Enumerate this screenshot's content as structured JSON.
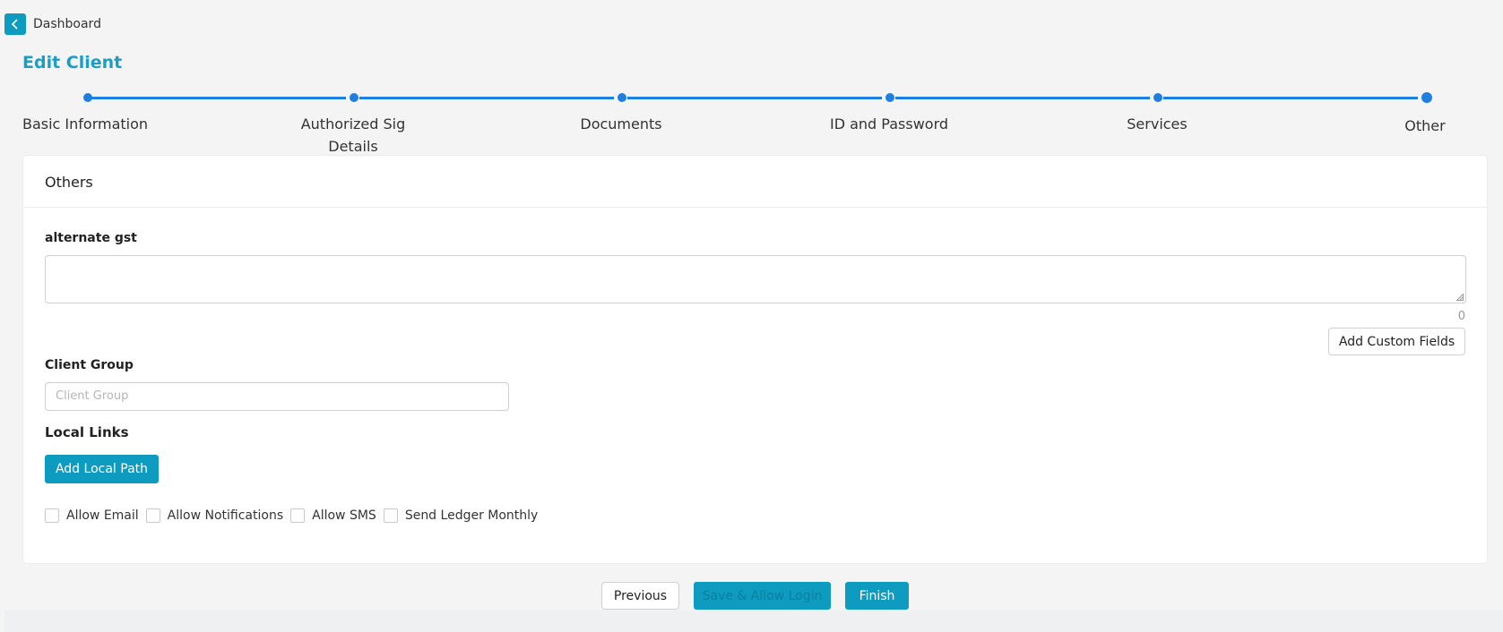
{
  "header": {
    "breadcrumb": "Dashboard",
    "title": "Edit Client"
  },
  "stepper": {
    "steps": [
      {
        "label": "Basic Information"
      },
      {
        "label": "Authorized Sig Details"
      },
      {
        "label": "Documents"
      },
      {
        "label": "ID and Password"
      },
      {
        "label": "Services"
      },
      {
        "label": "Other"
      }
    ],
    "active_index": 5
  },
  "card": {
    "title": "Others",
    "alternate_gst": {
      "label": "alternate gst",
      "value": "",
      "char_count": "0"
    },
    "add_custom_fields_label": "Add Custom Fields",
    "client_group": {
      "label": "Client Group",
      "placeholder": "Client Group",
      "value": ""
    },
    "local_links": {
      "label": "Local Links",
      "add_button": "Add Local Path"
    },
    "checkboxes": [
      {
        "label": "Allow Email",
        "checked": false
      },
      {
        "label": "Allow Notifications",
        "checked": false
      },
      {
        "label": "Allow SMS",
        "checked": false
      },
      {
        "label": "Send Ledger Monthly",
        "checked": false
      }
    ]
  },
  "footer": {
    "previous_label": "Previous",
    "save_allow_login_label": "Save & Allow Login",
    "finish_label": "Finish"
  },
  "colors": {
    "accent": "#0e9bc0",
    "stepper": "#1f7fe0",
    "title": "#1a9ec6"
  }
}
